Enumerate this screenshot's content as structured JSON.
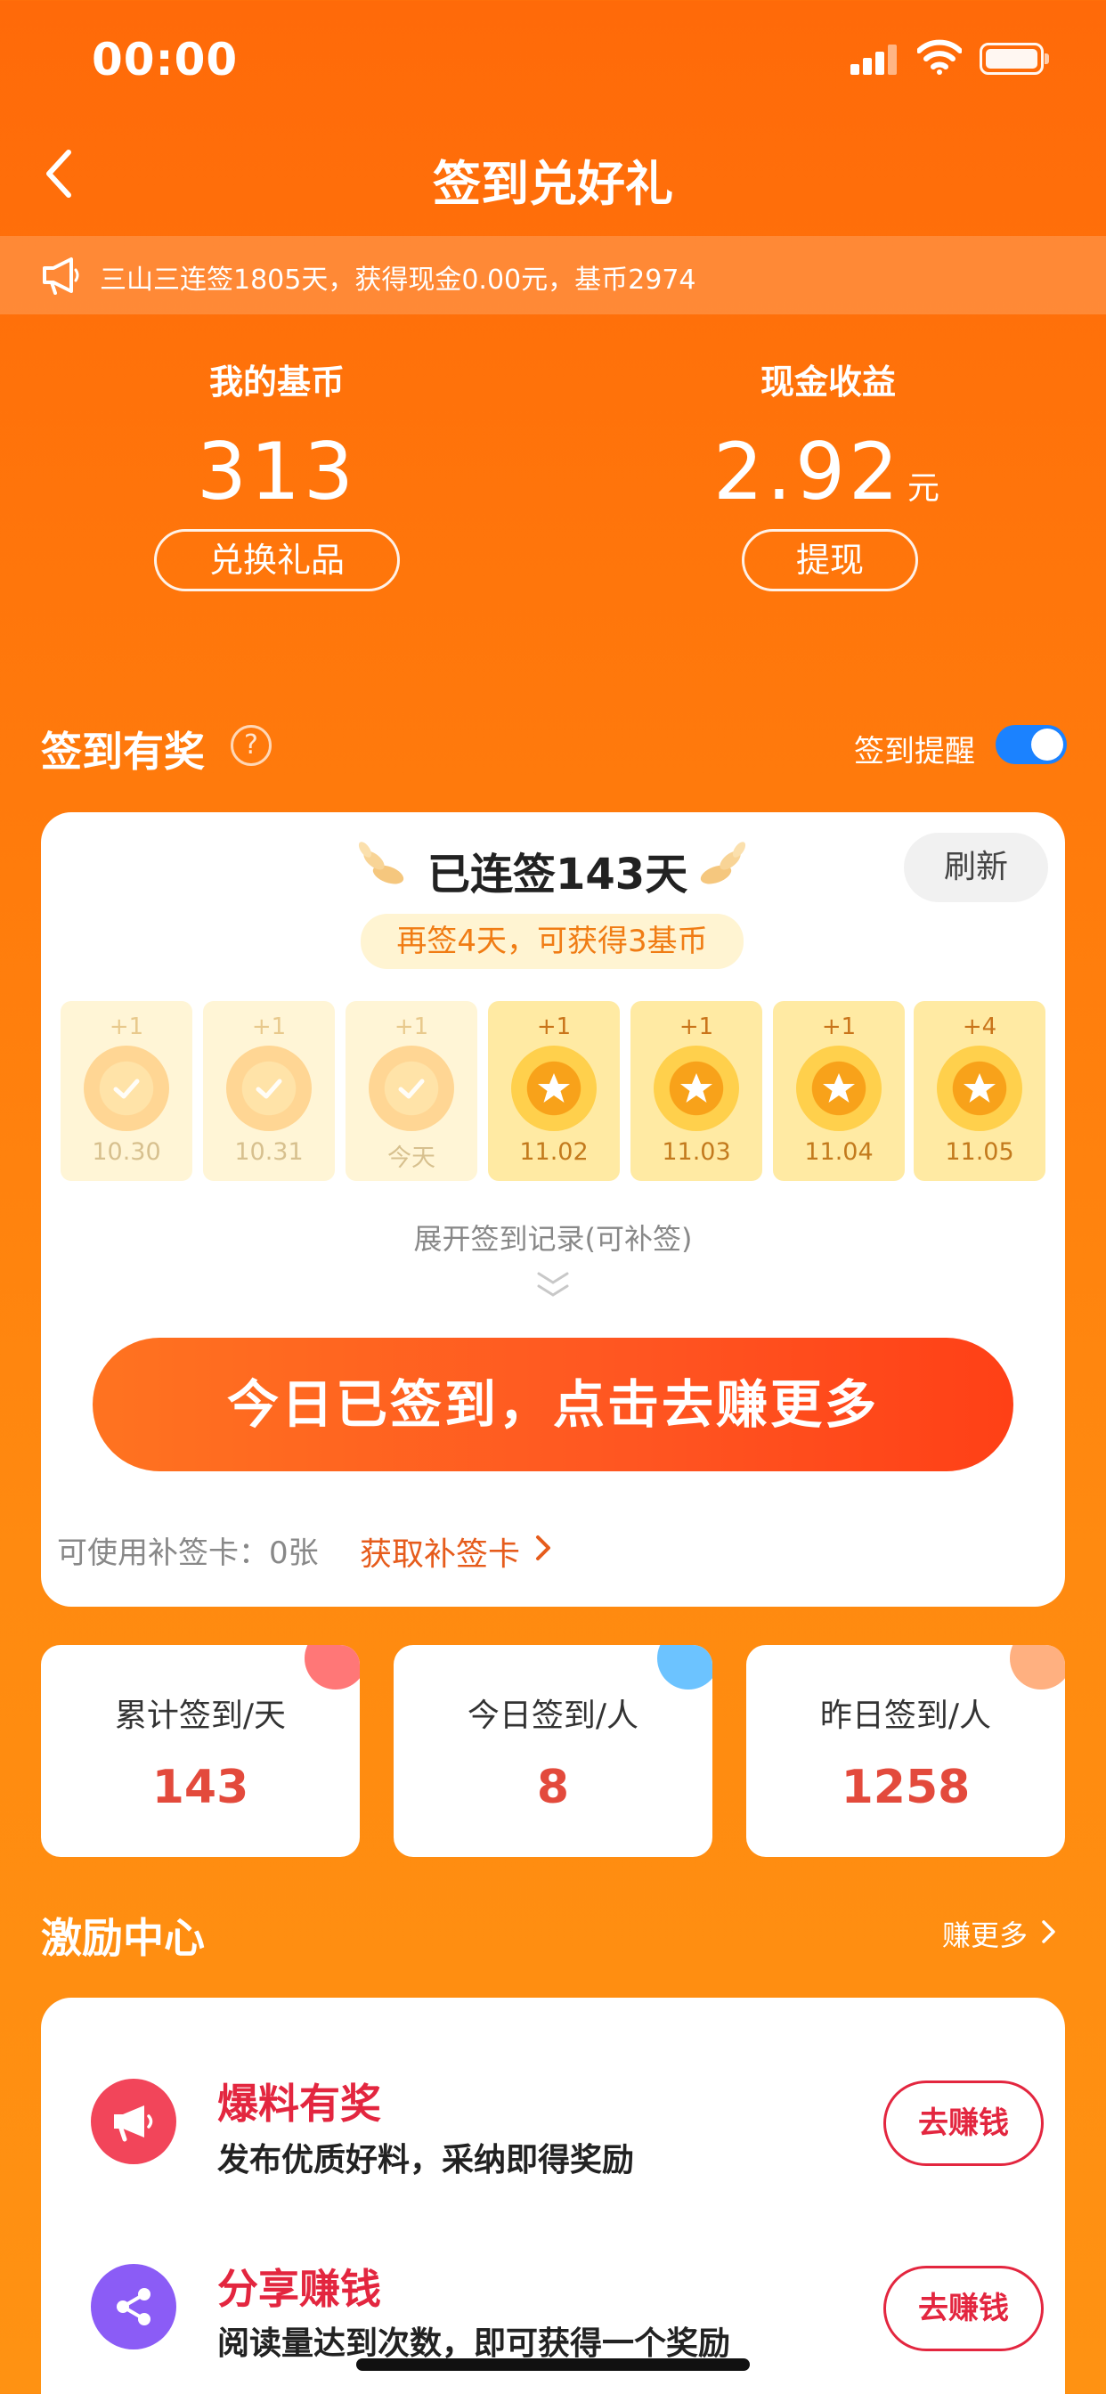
{
  "status_bar": {
    "time": "00:00"
  },
  "nav": {
    "title": "签到兑好礼"
  },
  "notice": {
    "text": "三山三连签1805天，获得现金0.00元，基币2974"
  },
  "balances": {
    "coins": {
      "label": "我的基币",
      "value": "313",
      "button": "兑换礼品"
    },
    "cash": {
      "label": "现金收益",
      "value": "2.92",
      "unit": "元",
      "button": "提现"
    }
  },
  "checkin": {
    "section_title": "签到有奖",
    "help": "?",
    "reminder_label": "签到提醒",
    "reminder_on": true,
    "streak_title": "已连签143天",
    "refresh_label": "刷新",
    "tip": "再签4天，可获得3基币",
    "days": [
      {
        "plus": "+1",
        "date": "10.30",
        "state": "signed"
      },
      {
        "plus": "+1",
        "date": "10.31",
        "state": "signed"
      },
      {
        "plus": "+1",
        "date": "今天",
        "state": "signed"
      },
      {
        "plus": "+1",
        "date": "11.02",
        "state": "upcoming"
      },
      {
        "plus": "+1",
        "date": "11.03",
        "state": "upcoming"
      },
      {
        "plus": "+1",
        "date": "11.04",
        "state": "upcoming"
      },
      {
        "plus": "+4",
        "date": "11.05",
        "state": "upcoming"
      }
    ],
    "expand_label": "展开签到记录(可补签)",
    "main_button": "今日已签到，点击去赚更多",
    "makeup_label": "可使用补签卡：0张",
    "makeup_link": "获取补签卡"
  },
  "stats": [
    {
      "label": "累计签到/天",
      "value": "143",
      "accent": "#ff6b6b"
    },
    {
      "label": "今日签到/人",
      "value": "8",
      "accent": "#6cc3ff"
    },
    {
      "label": "昨日签到/人",
      "value": "1258",
      "accent": "#ffb080"
    }
  ],
  "incentive": {
    "title": "激励中心",
    "more": "赚更多",
    "tasks": [
      {
        "title": "爆料有奖",
        "desc": "发布优质好料，采纳即得奖励",
        "button": "去赚钱",
        "icon": "megaphone-icon",
        "color": "#f2455a"
      },
      {
        "title": "分享赚钱",
        "desc": "阅读量达到次数，即可获得一个奖励",
        "button": "去赚钱",
        "icon": "share-icon",
        "color": "#8b5cf6"
      }
    ]
  }
}
